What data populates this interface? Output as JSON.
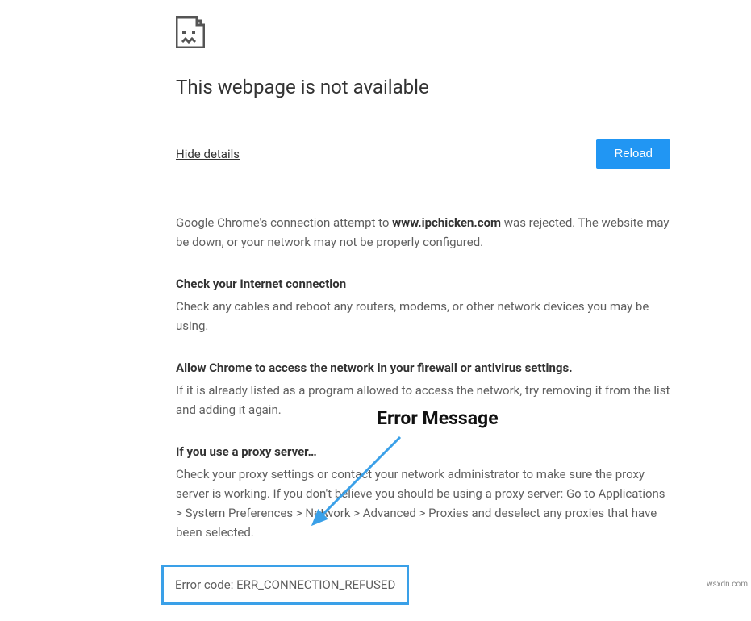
{
  "icon": "sad-page",
  "title": "This webpage is not available",
  "controls": {
    "hide_details": "Hide details",
    "reload": "Reload"
  },
  "details": {
    "intro_prefix": "Google Chrome's connection attempt to ",
    "hostname": "www.ipchicken.com",
    "intro_suffix": " was rejected. The website may be down, or your network may not be properly configured.",
    "suggestions": [
      {
        "heading": "Check your Internet connection",
        "text": "Check any cables and reboot any routers, modems, or other network devices you may be using."
      },
      {
        "heading": "Allow Chrome to access the network in your firewall or antivirus settings.",
        "text": "If it is already listed as a program allowed to access the network, try removing it from the list and adding it again."
      },
      {
        "heading": "If you use a proxy server…",
        "text": "Check your proxy settings or contact your network administrator to make sure the proxy server is working. If you don't believe you should be using a proxy server: Go to Applications > System Preferences > Network > Advanced > Proxies and deselect any proxies that have been selected."
      }
    ],
    "error_code_label": "Error code: ",
    "error_code_value": "ERR_CONNECTION_REFUSED"
  },
  "annotation": {
    "label": "Error Message"
  },
  "attribution": "wsxdn.com"
}
